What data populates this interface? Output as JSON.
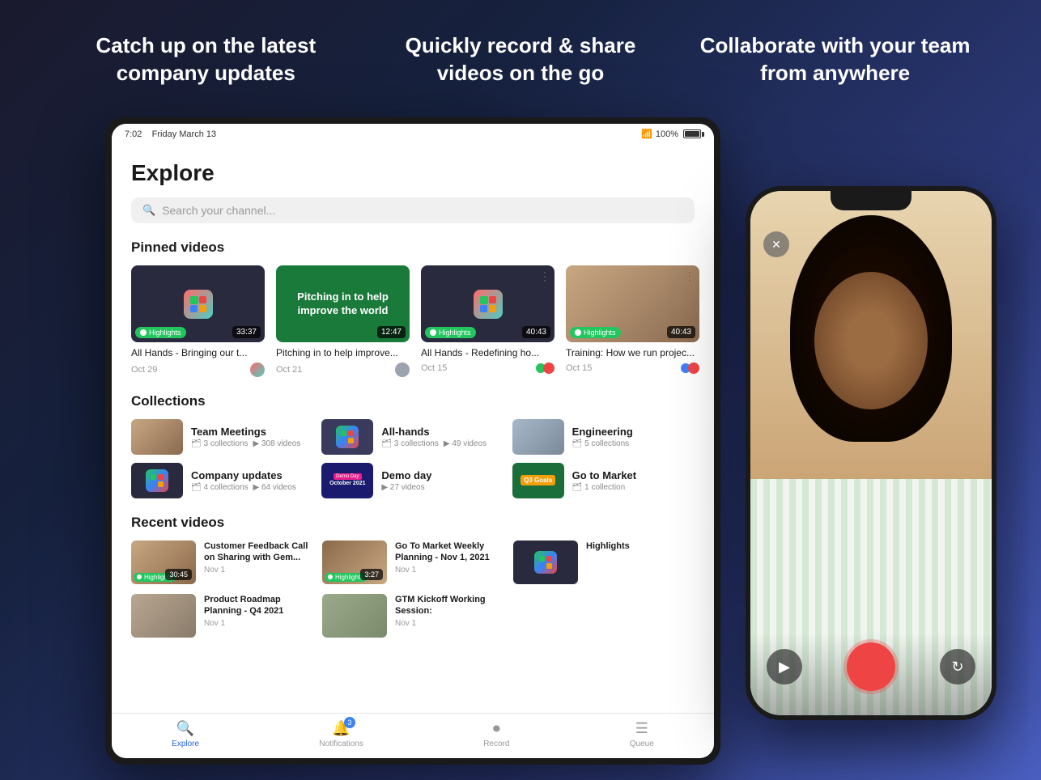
{
  "header": {
    "col1": "Catch up on the latest company updates",
    "col2": "Quickly record & share videos on the go",
    "col3": "Collaborate with your team from anywhere"
  },
  "tablet": {
    "statusBar": {
      "time": "7:02",
      "date": "Friday March 13",
      "wifi": "WiFi",
      "battery": "100%"
    },
    "explore": {
      "title": "Explore",
      "searchPlaceholder": "Search your channel..."
    },
    "pinnedVideos": {
      "sectionTitle": "Pinned videos",
      "videos": [
        {
          "title": "All Hands - Bringing our t...",
          "date": "Oct 29",
          "duration": "33:37",
          "hasHighlights": true,
          "thumbType": "dark"
        },
        {
          "title": "Pitching in to help improve...",
          "date": "Oct 21",
          "duration": "12:47",
          "hasHighlights": false,
          "thumbType": "green",
          "thumbText": "Pitching in to help improve the world"
        },
        {
          "title": "All Hands - Redefining ho...",
          "date": "Oct 15",
          "duration": "40:43",
          "hasHighlights": true,
          "thumbType": "dark"
        },
        {
          "title": "Training: How we run projec...",
          "date": "Oct 15",
          "duration": "40:43",
          "hasHighlights": true,
          "thumbType": "person"
        }
      ]
    },
    "collections": {
      "sectionTitle": "Collections",
      "items": [
        {
          "name": "Team Meetings",
          "collections": "3 collections",
          "videos": "308 videos",
          "thumbType": "person"
        },
        {
          "name": "All-hands",
          "collections": "3 collections",
          "videos": "49 videos",
          "thumbType": "dark"
        },
        {
          "name": "Engineering",
          "collections": "5 collections",
          "videos": "",
          "thumbType": "person2"
        },
        {
          "name": "Company updates",
          "collections": "4 collections",
          "videos": "64 videos",
          "thumbType": "dark2"
        },
        {
          "name": "Demo day",
          "collections": "",
          "videos": "27 videos",
          "thumbType": "demo"
        },
        {
          "name": "Go to Market",
          "collections": "1 collection",
          "videos": "",
          "thumbType": "q3"
        }
      ]
    },
    "recentVideos": {
      "sectionTitle": "Recent videos",
      "items": [
        {
          "title": "Customer Feedback Call on Sharing with Gem...",
          "date": "Nov 1",
          "duration": "30:45",
          "hasHighlights": true,
          "thumbType": "person1"
        },
        {
          "title": "Go To Market Weekly Planning - Nov 1, 2021",
          "date": "Nov 1",
          "duration": "3:27",
          "hasHighlights": true,
          "thumbType": "person2"
        },
        {
          "title": "Highlights",
          "date": "",
          "duration": "",
          "hasHighlights": false,
          "thumbType": "dark"
        },
        {
          "title": "Product Roadmap Planning - Q4 2021",
          "date": "Nov 1",
          "duration": "",
          "hasHighlights": false,
          "thumbType": "person3"
        },
        {
          "title": "GTM Kickoff Working Session:",
          "date": "Nov 1",
          "duration": "",
          "hasHighlights": false,
          "thumbType": "person4"
        }
      ]
    },
    "tabBar": {
      "tabs": [
        {
          "label": "Explore",
          "icon": "🔍",
          "active": true
        },
        {
          "label": "Notifications",
          "icon": "🔔",
          "badge": "3"
        },
        {
          "label": "Record",
          "icon": "⏺"
        },
        {
          "label": "Queue",
          "icon": "☰"
        }
      ]
    }
  },
  "phone": {
    "closeButton": "✕",
    "bottomIcons": {
      "left": "▶",
      "right": "↻"
    }
  }
}
